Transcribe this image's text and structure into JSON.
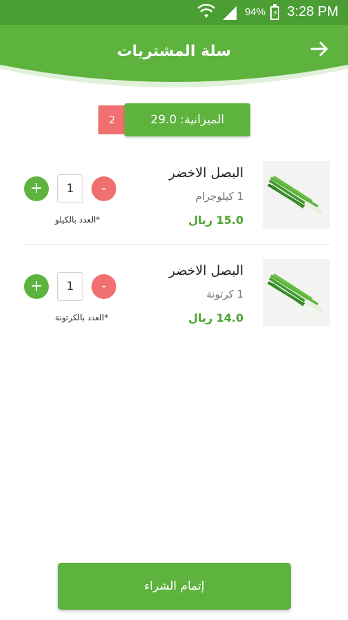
{
  "status_bar": {
    "battery_percent": "94%",
    "time": "3:28 PM"
  },
  "header": {
    "title": "سلة المشتريات"
  },
  "budget": {
    "item_count": "2",
    "label": "الميزانية: 29.0"
  },
  "items": [
    {
      "name": "البصل الاخضر",
      "unit": "1 كيلوجرام",
      "price": "15.0 ريال",
      "quantity": "1",
      "note": "*العدد بالكيلو"
    },
    {
      "name": "البصل الاخضر",
      "unit": "1 كرتونة",
      "price": "14.0 ريال",
      "quantity": "1",
      "note": "*العدد بالكرتونة"
    }
  ],
  "controls": {
    "minus": "-",
    "plus": "+"
  },
  "checkout": {
    "label": "إتمام الشراء"
  },
  "colors": {
    "primary_green": "#5db33d",
    "status_bar": "#4a9e34",
    "decrement_red": "#f07070",
    "price_green": "#4aa52e"
  }
}
